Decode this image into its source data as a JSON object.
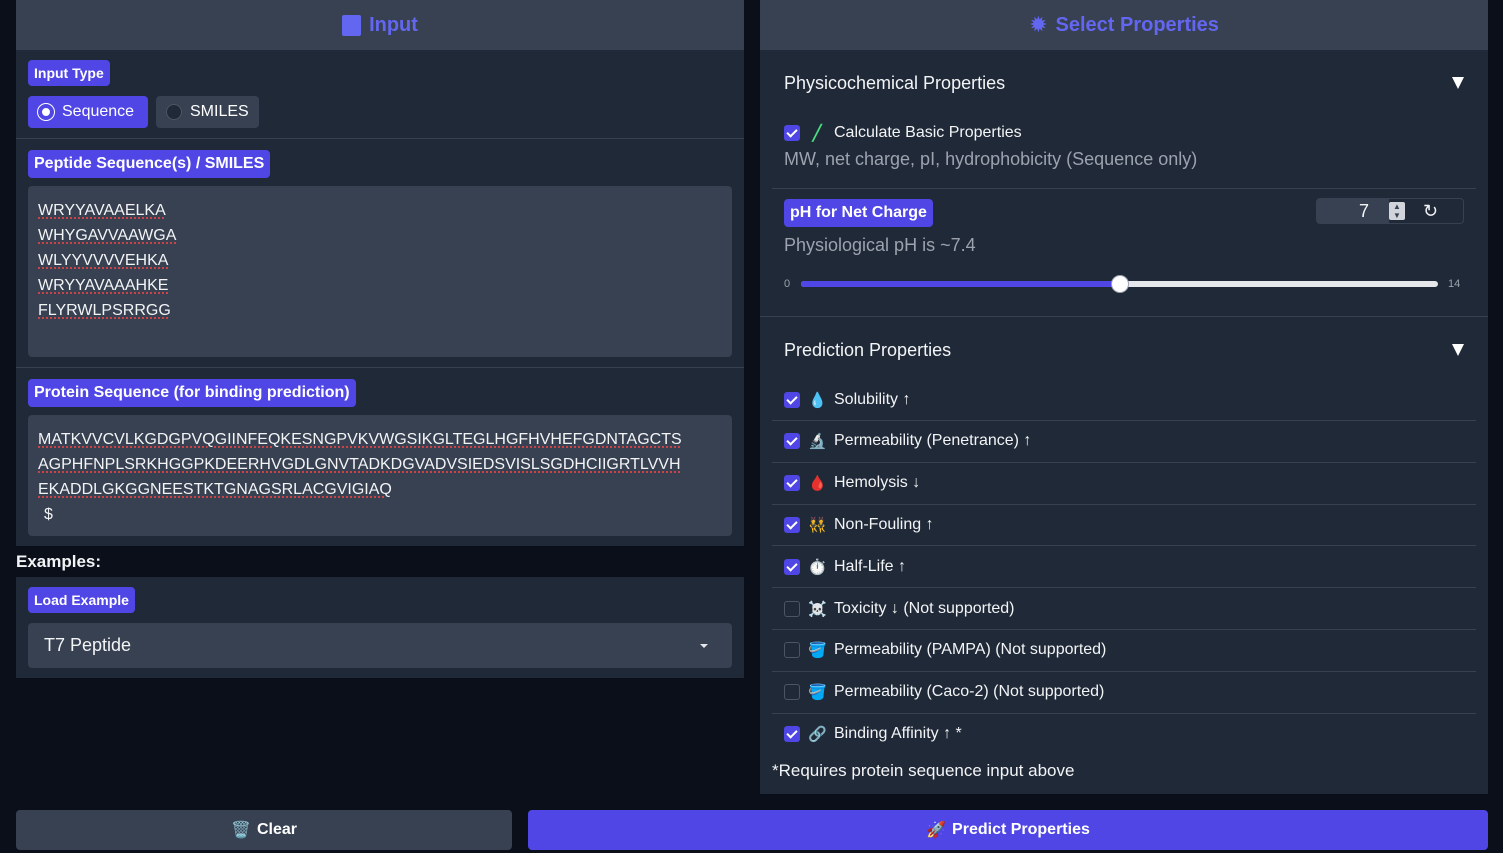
{
  "input_panel": {
    "title": "Input",
    "input_type_label": "Input Type",
    "options": [
      "Sequence",
      "SMILES"
    ],
    "selected_option": "Sequence",
    "peptide_label": "Peptide Sequence(s) / SMILES",
    "peptide_lines": [
      "WRYYAVAAELKA",
      "WHYGAVVAAWGA",
      "WLYYVVVVEHKA",
      "WRYYAVAAAHKE",
      "FLYRWLPSRRGG"
    ],
    "protein_label": "Protein Sequence (for binding prediction)",
    "protein_lines": [
      "MATKVVCVLKGDGPVQGIINFEQKESNGPVKVWGSIKGLTEGLHGFHVHEFGDNTAGCTS",
      "AGPHFNPLSRKHGGPKDEERHVGDLGNVTADKDGVADVSIEDSVISLSGDHCIIGRTLVVH",
      "EKADDLGKGGNEESTKTGNAGSRLACGVIGIAQ",
      "$"
    ],
    "examples_heading": "Examples:",
    "load_example_label": "Load Example",
    "example_selected": "T7 Peptide"
  },
  "properties_panel": {
    "title": "Select Properties",
    "physico_heading": "Physicochemical Properties",
    "basic_label": "Calculate Basic Properties",
    "basic_desc": "MW, net charge, pI, hydrophobicity (Sequence only)",
    "ph_label": "pH for Net Charge",
    "ph_desc": "Physiological pH is ~7.4",
    "ph_value": "7",
    "slider_min": "0",
    "slider_max": "14",
    "slider_value": 7,
    "prediction_heading": "Prediction Properties",
    "properties": [
      {
        "emoji": "💧",
        "label": "Solubility ↑",
        "checked": true
      },
      {
        "emoji": "🔬",
        "label": "Permeability (Penetrance) ↑",
        "checked": true
      },
      {
        "emoji": "🩸",
        "label": "Hemolysis ↓",
        "checked": true
      },
      {
        "emoji": "👯",
        "label": "Non-Fouling ↑",
        "checked": true
      },
      {
        "emoji": "⏱️",
        "label": "Half-Life ↑",
        "checked": true
      },
      {
        "emoji": "☠️",
        "label": "Toxicity ↓ (Not supported)",
        "checked": false
      },
      {
        "emoji": "🪣",
        "label": "Permeability (PAMPA) (Not supported)",
        "checked": false
      },
      {
        "emoji": "🪣",
        "label": "Permeability (Caco-2) (Not supported)",
        "checked": false
      },
      {
        "emoji": "🔗",
        "label": "Binding Affinity ↑ *",
        "checked": true
      }
    ],
    "footnote": "*Requires protein sequence input above"
  },
  "buttons": {
    "clear": "Clear",
    "clear_emoji": "🗑️",
    "predict": "Predict Properties",
    "predict_emoji": "🚀"
  },
  "colors": {
    "accent": "#4f46e5",
    "panel": "#1f2937",
    "header": "#374151",
    "background": "#0b0f19"
  }
}
